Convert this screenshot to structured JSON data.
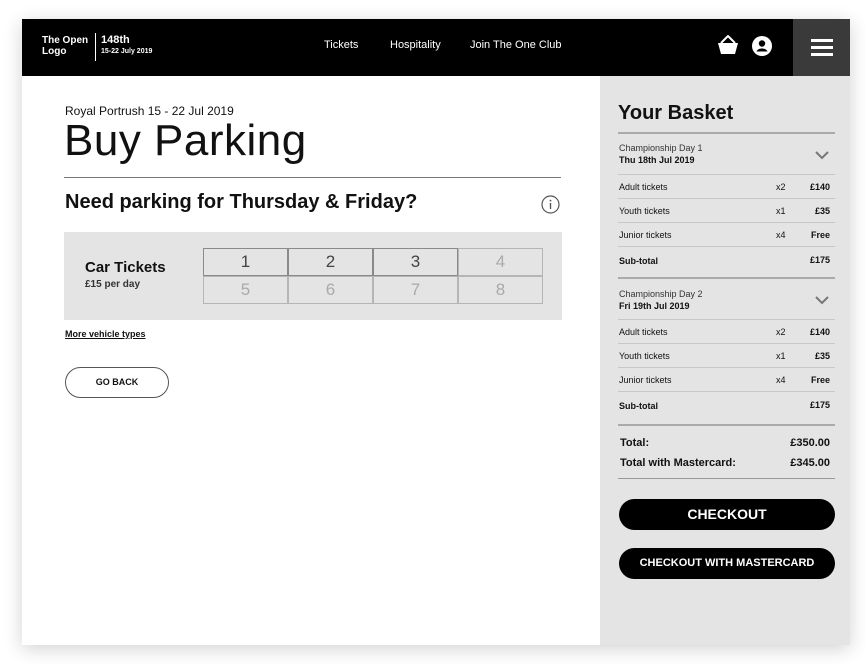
{
  "header": {
    "logo": "The Open Logo",
    "edition_number": "148th",
    "edition_dates": "15-22 July 2019",
    "nav": [
      "Tickets",
      "Hospitality",
      "Join The One Club"
    ]
  },
  "main": {
    "event_line": "Royal Portrush 15 - 22 Jul 2019",
    "title": "Buy Parking",
    "question": "Need parking for Thursday & Friday?",
    "car_tickets": {
      "title": "Car Tickets",
      "price": "£15 per day",
      "quantities": [
        "1",
        "2",
        "3",
        "4",
        "5",
        "6",
        "7",
        "8"
      ],
      "enabled_count": 3
    },
    "more_vehicles": "More vehicle types",
    "go_back": "GO BACK"
  },
  "basket": {
    "title": "Your Basket",
    "days": [
      {
        "label": "Championship Day 1",
        "date": "Thu 18th Jul 2019",
        "rows": [
          {
            "label": "Adult tickets",
            "qty": "x2",
            "price": "£140"
          },
          {
            "label": "Youth tickets",
            "qty": "x1",
            "price": "£35"
          },
          {
            "label": "Junior tickets",
            "qty": "x4",
            "price": "Free"
          }
        ],
        "subtotal_label": "Sub-total",
        "subtotal": "£175"
      },
      {
        "label": "Championship Day 2",
        "date": "Fri 19th Jul 2019",
        "rows": [
          {
            "label": "Adult tickets",
            "qty": "x2",
            "price": "£140"
          },
          {
            "label": "Youth tickets",
            "qty": "x1",
            "price": "£35"
          },
          {
            "label": "Junior tickets",
            "qty": "x4",
            "price": "Free"
          }
        ],
        "subtotal_label": "Sub-total",
        "subtotal": "£175"
      }
    ],
    "total_label": "Total:",
    "total": "£350.00",
    "total_mc_label": "Total with Mastercard:",
    "total_mc": "£345.00",
    "checkout": "CHECKOUT",
    "checkout_mc": "CHECKOUT WITH MASTERCARD"
  },
  "colors": {
    "header_bg": "#000000",
    "menu_bg": "#3a3a3a",
    "panel_bg": "#e4e4e4"
  }
}
